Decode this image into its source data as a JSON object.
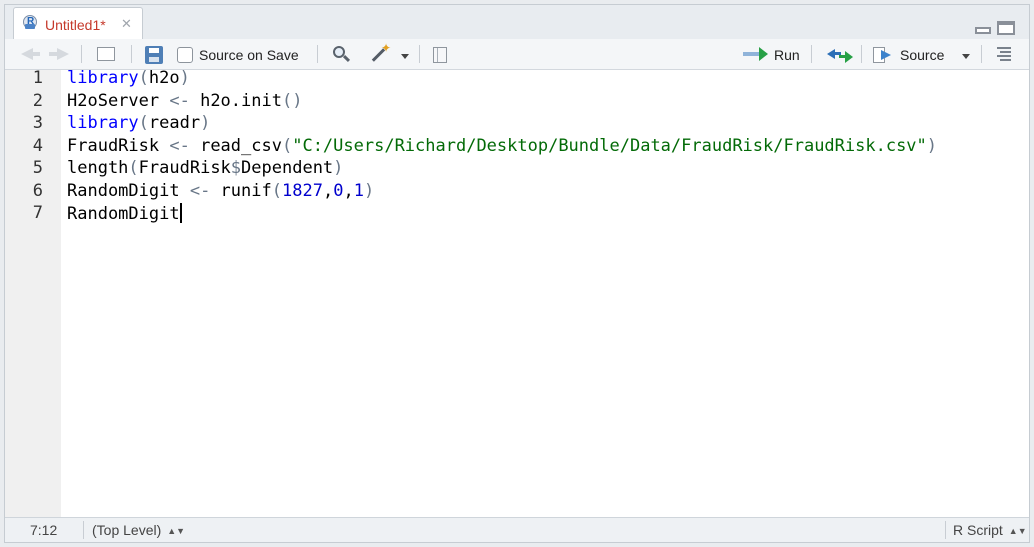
{
  "tab": {
    "title": "Untitled1*",
    "close_glyph": "✕"
  },
  "toolbar": {
    "source_on_save": "Source on Save",
    "run": "Run",
    "source": "Source"
  },
  "editor": {
    "line_numbers": [
      "1",
      "2",
      "3",
      "4",
      "5",
      "6",
      "7"
    ],
    "lines": [
      [
        {
          "t": "library",
          "c": "kw"
        },
        {
          "t": "(",
          "c": "op"
        },
        {
          "t": "h2o",
          "c": ""
        },
        {
          "t": ")",
          "c": "op"
        }
      ],
      [
        {
          "t": "H2oServer ",
          "c": ""
        },
        {
          "t": "<-",
          "c": "op"
        },
        {
          "t": " h2o.init",
          "c": ""
        },
        {
          "t": "()",
          "c": "op"
        }
      ],
      [
        {
          "t": "library",
          "c": "kw"
        },
        {
          "t": "(",
          "c": "op"
        },
        {
          "t": "readr",
          "c": ""
        },
        {
          "t": ")",
          "c": "op"
        }
      ],
      [
        {
          "t": "FraudRisk ",
          "c": ""
        },
        {
          "t": "<-",
          "c": "op"
        },
        {
          "t": " read_csv",
          "c": ""
        },
        {
          "t": "(",
          "c": "op"
        },
        {
          "t": "\"C:/Users/Richard/Desktop/Bundle/Data/FraudRisk/FraudRisk.csv\"",
          "c": "str"
        },
        {
          "t": ")",
          "c": "op"
        }
      ],
      [
        {
          "t": "length",
          "c": ""
        },
        {
          "t": "(",
          "c": "op"
        },
        {
          "t": "FraudRisk",
          "c": ""
        },
        {
          "t": "$",
          "c": "op"
        },
        {
          "t": "Dependent",
          "c": ""
        },
        {
          "t": ")",
          "c": "op"
        }
      ],
      [
        {
          "t": "RandomDigit ",
          "c": ""
        },
        {
          "t": "<-",
          "c": "op"
        },
        {
          "t": " runif",
          "c": ""
        },
        {
          "t": "(",
          "c": "op"
        },
        {
          "t": "1827",
          "c": "num"
        },
        {
          "t": ",",
          "c": ""
        },
        {
          "t": "0",
          "c": "num"
        },
        {
          "t": ",",
          "c": ""
        },
        {
          "t": "1",
          "c": "num"
        },
        {
          "t": ")",
          "c": "op"
        }
      ],
      [
        {
          "t": "RandomDigit",
          "c": ""
        }
      ]
    ]
  },
  "status": {
    "cursor_pos": "7:12",
    "scope": "(Top Level)",
    "file_type": "R Script",
    "updown_glyph": "▲▼"
  },
  "icons": {
    "r-file": "r-logo-icon",
    "save": "save-icon",
    "search": "search-icon",
    "magic": "magic-wand-icon",
    "notebook": "compile-notebook-icon",
    "run": "run-arrow-icon",
    "rerun": "rerun-icon",
    "source": "source-icon",
    "outline": "outline-icon"
  },
  "colors": {
    "keyword": "#0000ff",
    "string": "#036a07",
    "number": "#0000cd",
    "tab_title": "#c5392b"
  }
}
